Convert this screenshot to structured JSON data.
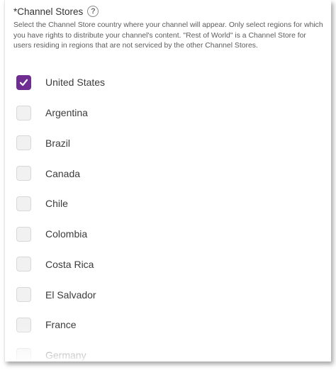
{
  "field": {
    "label": "*Channel Stores",
    "help_icon": "question-circle-icon",
    "description": "Select the Channel Store country where your channel will appear. Only select regions for which you have rights to distribute your channel's content. \"Rest of World\" is a Channel Store for users residing in regions that are not serviced by the other Channel Stores."
  },
  "stores": [
    {
      "label": "United States",
      "checked": true
    },
    {
      "label": "Argentina",
      "checked": false
    },
    {
      "label": "Brazil",
      "checked": false
    },
    {
      "label": "Canada",
      "checked": false
    },
    {
      "label": "Chile",
      "checked": false
    },
    {
      "label": "Colombia",
      "checked": false
    },
    {
      "label": "Costa Rica",
      "checked": false
    },
    {
      "label": "El Salvador",
      "checked": false
    },
    {
      "label": "France",
      "checked": false
    },
    {
      "label": "Germany",
      "checked": false
    }
  ],
  "colors": {
    "accent": "#6f2c91",
    "unchecked_fill": "#f1f1f1"
  }
}
